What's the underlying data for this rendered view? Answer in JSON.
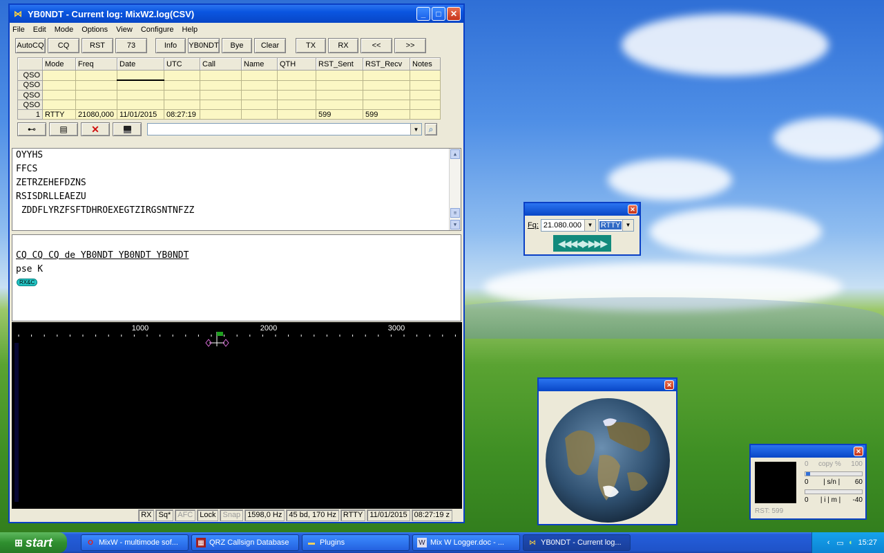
{
  "main_window": {
    "title": "YB0NDT - Current log: MixW2.log(CSV)",
    "menu": [
      "File",
      "Edit",
      "Mode",
      "Options",
      "View",
      "Configure",
      "Help"
    ],
    "toolbar": [
      "AutoCQ",
      "CQ",
      "RST",
      "73",
      "Info",
      "YB0NDT",
      "Bye",
      "Clear",
      "TX",
      "RX",
      "<<",
      ">>"
    ],
    "log_columns": [
      "Mode",
      "Freq",
      "Date",
      "UTC",
      "Call",
      "Name",
      "QTH",
      "RST_Sent",
      "RST_Recv",
      "Notes"
    ],
    "log_rows": [
      {
        "label": "QSO",
        "cells": [
          "",
          "",
          "",
          "",
          "",
          "",
          "",
          "",
          "",
          ""
        ]
      },
      {
        "label": "QSO",
        "cells": [
          "",
          "",
          "",
          "",
          "",
          "",
          "",
          "",
          "",
          ""
        ]
      },
      {
        "label": "QSO",
        "cells": [
          "",
          "",
          "",
          "",
          "",
          "",
          "",
          "",
          "",
          ""
        ]
      },
      {
        "label": "QSO",
        "cells": [
          "",
          "",
          "",
          "",
          "",
          "",
          "",
          "",
          "",
          ""
        ]
      },
      {
        "label": "1",
        "cells": [
          "RTTY",
          "21080,000",
          "11/01/2015",
          "08:27:19",
          "",
          "",
          "",
          "599",
          "599",
          ""
        ]
      }
    ],
    "receive_text": [
      "OYYHS",
      "FFCS",
      "ZETRZEHEFDZNS",
      "RSISDRLLEAEZU",
      " ZDDFLYRZFSFTDHROEXEGTZIRGSNTNFZZ"
    ],
    "transmit_text": [
      "CQ CQ CQ de YB0NDT YB0NDT YB0NDT",
      "pse K"
    ],
    "rx_badge": "RX&C",
    "waterfall_scale": [
      "1000",
      "2000",
      "3000"
    ],
    "status": {
      "rx": "RX",
      "sq": "Sq*",
      "afc": "AFC",
      "lock": "Lock",
      "snap": "Snap",
      "freq": "1598,0 Hz",
      "baud": "45 bd, 170 Hz",
      "mode": "RTTY",
      "date": "11/01/2015",
      "time": "08:27:19 z"
    }
  },
  "freq_window": {
    "label": "Fq:",
    "freq": "21.080.000",
    "mode": "RTTY"
  },
  "meter_window": {
    "copy_min": "0",
    "copy_label": "copy %",
    "copy_max": "100",
    "sn_min": "0",
    "sn_label": "| s/n |",
    "sn_max": "60",
    "imd_min": "0",
    "imd_label": "| i | m |",
    "imd_max": "-40",
    "rst": "RST: 599"
  },
  "taskbar": {
    "start": "start",
    "tasks": [
      "MixW - multimode sof...",
      "QRZ Callsign Database",
      "Plugins",
      "Mix W  Logger.doc - ...",
      "YB0NDT - Current log..."
    ],
    "clock": "15:27"
  },
  "colors": {
    "accent": "#0a55e0",
    "log_cell": "#fbf7c4",
    "waterfall": "#000000",
    "cursor": "#1fa01f"
  }
}
